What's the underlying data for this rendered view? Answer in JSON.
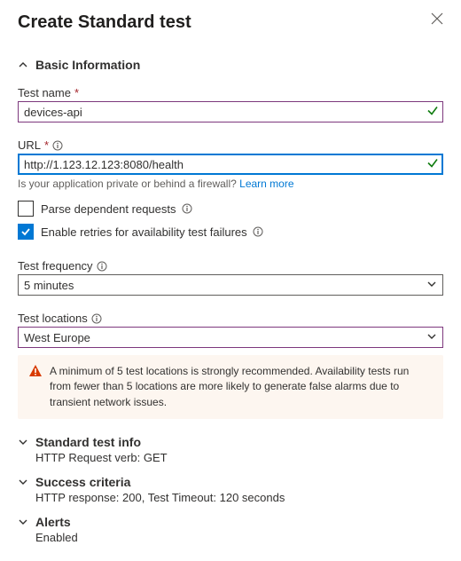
{
  "header": {
    "title": "Create Standard test"
  },
  "basic": {
    "section_label": "Basic Information",
    "test_name_label": "Test name",
    "test_name_value": "devices-api",
    "url_label": "URL",
    "url_value": "http://1.123.12.123:8080/health",
    "url_hint_prefix": "Is your application private or behind a firewall? ",
    "url_hint_link": "Learn more",
    "parse_requests_label": "Parse dependent requests",
    "enable_retries_label": "Enable retries for availability test failures",
    "frequency_label": "Test frequency",
    "frequency_value": "5 minutes",
    "locations_label": "Test locations",
    "locations_value": "West Europe",
    "warning_text": "A minimum of 5 test locations is strongly recommended. Availability tests run from fewer than 5 locations are more likely to generate false alarms due to transient network issues."
  },
  "std_info": {
    "label": "Standard test info",
    "body": "HTTP Request verb: GET"
  },
  "success": {
    "label": "Success criteria",
    "body": "HTTP response: 200, Test Timeout: 120 seconds"
  },
  "alerts": {
    "label": "Alerts",
    "body": "Enabled"
  }
}
